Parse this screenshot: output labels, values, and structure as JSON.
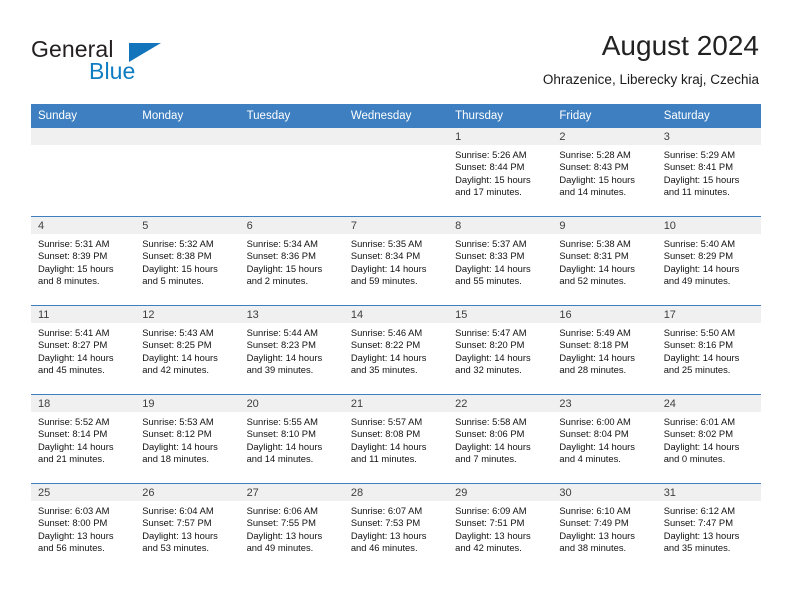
{
  "brand": {
    "line1": "General",
    "line2": "Blue",
    "triangle_color": "#1275bc",
    "text_color": "#231f20"
  },
  "header": {
    "title": "August 2024",
    "subtitle": "Ohrazenice, Liberecky kraj, Czechia",
    "header_bg_color": "#3d7fc1",
    "header_text_color": "#ffffff",
    "daynum_strip_color": "#f0f0f0"
  },
  "weekday_headers": [
    "Sunday",
    "Monday",
    "Tuesday",
    "Wednesday",
    "Thursday",
    "Friday",
    "Saturday"
  ],
  "weeks": [
    [
      {
        "day": "",
        "sunrise": "",
        "sunset": "",
        "daylight_line1": "",
        "daylight_line2": "",
        "empty": true
      },
      {
        "day": "",
        "sunrise": "",
        "sunset": "",
        "daylight_line1": "",
        "daylight_line2": "",
        "empty": true
      },
      {
        "day": "",
        "sunrise": "",
        "sunset": "",
        "daylight_line1": "",
        "daylight_line2": "",
        "empty": true
      },
      {
        "day": "",
        "sunrise": "",
        "sunset": "",
        "daylight_line1": "",
        "daylight_line2": "",
        "empty": true
      },
      {
        "day": "1",
        "sunrise": "Sunrise: 5:26 AM",
        "sunset": "Sunset: 8:44 PM",
        "daylight_line1": "Daylight: 15 hours",
        "daylight_line2": "and 17 minutes."
      },
      {
        "day": "2",
        "sunrise": "Sunrise: 5:28 AM",
        "sunset": "Sunset: 8:43 PM",
        "daylight_line1": "Daylight: 15 hours",
        "daylight_line2": "and 14 minutes."
      },
      {
        "day": "3",
        "sunrise": "Sunrise: 5:29 AM",
        "sunset": "Sunset: 8:41 PM",
        "daylight_line1": "Daylight: 15 hours",
        "daylight_line2": "and 11 minutes."
      }
    ],
    [
      {
        "day": "4",
        "sunrise": "Sunrise: 5:31 AM",
        "sunset": "Sunset: 8:39 PM",
        "daylight_line1": "Daylight: 15 hours",
        "daylight_line2": "and 8 minutes."
      },
      {
        "day": "5",
        "sunrise": "Sunrise: 5:32 AM",
        "sunset": "Sunset: 8:38 PM",
        "daylight_line1": "Daylight: 15 hours",
        "daylight_line2": "and 5 minutes."
      },
      {
        "day": "6",
        "sunrise": "Sunrise: 5:34 AM",
        "sunset": "Sunset: 8:36 PM",
        "daylight_line1": "Daylight: 15 hours",
        "daylight_line2": "and 2 minutes."
      },
      {
        "day": "7",
        "sunrise": "Sunrise: 5:35 AM",
        "sunset": "Sunset: 8:34 PM",
        "daylight_line1": "Daylight: 14 hours",
        "daylight_line2": "and 59 minutes."
      },
      {
        "day": "8",
        "sunrise": "Sunrise: 5:37 AM",
        "sunset": "Sunset: 8:33 PM",
        "daylight_line1": "Daylight: 14 hours",
        "daylight_line2": "and 55 minutes."
      },
      {
        "day": "9",
        "sunrise": "Sunrise: 5:38 AM",
        "sunset": "Sunset: 8:31 PM",
        "daylight_line1": "Daylight: 14 hours",
        "daylight_line2": "and 52 minutes."
      },
      {
        "day": "10",
        "sunrise": "Sunrise: 5:40 AM",
        "sunset": "Sunset: 8:29 PM",
        "daylight_line1": "Daylight: 14 hours",
        "daylight_line2": "and 49 minutes."
      }
    ],
    [
      {
        "day": "11",
        "sunrise": "Sunrise: 5:41 AM",
        "sunset": "Sunset: 8:27 PM",
        "daylight_line1": "Daylight: 14 hours",
        "daylight_line2": "and 45 minutes."
      },
      {
        "day": "12",
        "sunrise": "Sunrise: 5:43 AM",
        "sunset": "Sunset: 8:25 PM",
        "daylight_line1": "Daylight: 14 hours",
        "daylight_line2": "and 42 minutes."
      },
      {
        "day": "13",
        "sunrise": "Sunrise: 5:44 AM",
        "sunset": "Sunset: 8:23 PM",
        "daylight_line1": "Daylight: 14 hours",
        "daylight_line2": "and 39 minutes."
      },
      {
        "day": "14",
        "sunrise": "Sunrise: 5:46 AM",
        "sunset": "Sunset: 8:22 PM",
        "daylight_line1": "Daylight: 14 hours",
        "daylight_line2": "and 35 minutes."
      },
      {
        "day": "15",
        "sunrise": "Sunrise: 5:47 AM",
        "sunset": "Sunset: 8:20 PM",
        "daylight_line1": "Daylight: 14 hours",
        "daylight_line2": "and 32 minutes."
      },
      {
        "day": "16",
        "sunrise": "Sunrise: 5:49 AM",
        "sunset": "Sunset: 8:18 PM",
        "daylight_line1": "Daylight: 14 hours",
        "daylight_line2": "and 28 minutes."
      },
      {
        "day": "17",
        "sunrise": "Sunrise: 5:50 AM",
        "sunset": "Sunset: 8:16 PM",
        "daylight_line1": "Daylight: 14 hours",
        "daylight_line2": "and 25 minutes."
      }
    ],
    [
      {
        "day": "18",
        "sunrise": "Sunrise: 5:52 AM",
        "sunset": "Sunset: 8:14 PM",
        "daylight_line1": "Daylight: 14 hours",
        "daylight_line2": "and 21 minutes."
      },
      {
        "day": "19",
        "sunrise": "Sunrise: 5:53 AM",
        "sunset": "Sunset: 8:12 PM",
        "daylight_line1": "Daylight: 14 hours",
        "daylight_line2": "and 18 minutes."
      },
      {
        "day": "20",
        "sunrise": "Sunrise: 5:55 AM",
        "sunset": "Sunset: 8:10 PM",
        "daylight_line1": "Daylight: 14 hours",
        "daylight_line2": "and 14 minutes."
      },
      {
        "day": "21",
        "sunrise": "Sunrise: 5:57 AM",
        "sunset": "Sunset: 8:08 PM",
        "daylight_line1": "Daylight: 14 hours",
        "daylight_line2": "and 11 minutes."
      },
      {
        "day": "22",
        "sunrise": "Sunrise: 5:58 AM",
        "sunset": "Sunset: 8:06 PM",
        "daylight_line1": "Daylight: 14 hours",
        "daylight_line2": "and 7 minutes."
      },
      {
        "day": "23",
        "sunrise": "Sunrise: 6:00 AM",
        "sunset": "Sunset: 8:04 PM",
        "daylight_line1": "Daylight: 14 hours",
        "daylight_line2": "and 4 minutes."
      },
      {
        "day": "24",
        "sunrise": "Sunrise: 6:01 AM",
        "sunset": "Sunset: 8:02 PM",
        "daylight_line1": "Daylight: 14 hours",
        "daylight_line2": "and 0 minutes."
      }
    ],
    [
      {
        "day": "25",
        "sunrise": "Sunrise: 6:03 AM",
        "sunset": "Sunset: 8:00 PM",
        "daylight_line1": "Daylight: 13 hours",
        "daylight_line2": "and 56 minutes."
      },
      {
        "day": "26",
        "sunrise": "Sunrise: 6:04 AM",
        "sunset": "Sunset: 7:57 PM",
        "daylight_line1": "Daylight: 13 hours",
        "daylight_line2": "and 53 minutes."
      },
      {
        "day": "27",
        "sunrise": "Sunrise: 6:06 AM",
        "sunset": "Sunset: 7:55 PM",
        "daylight_line1": "Daylight: 13 hours",
        "daylight_line2": "and 49 minutes."
      },
      {
        "day": "28",
        "sunrise": "Sunrise: 6:07 AM",
        "sunset": "Sunset: 7:53 PM",
        "daylight_line1": "Daylight: 13 hours",
        "daylight_line2": "and 46 minutes."
      },
      {
        "day": "29",
        "sunrise": "Sunrise: 6:09 AM",
        "sunset": "Sunset: 7:51 PM",
        "daylight_line1": "Daylight: 13 hours",
        "daylight_line2": "and 42 minutes."
      },
      {
        "day": "30",
        "sunrise": "Sunrise: 6:10 AM",
        "sunset": "Sunset: 7:49 PM",
        "daylight_line1": "Daylight: 13 hours",
        "daylight_line2": "and 38 minutes."
      },
      {
        "day": "31",
        "sunrise": "Sunrise: 6:12 AM",
        "sunset": "Sunset: 7:47 PM",
        "daylight_line1": "Daylight: 13 hours",
        "daylight_line2": "and 35 minutes."
      }
    ]
  ]
}
